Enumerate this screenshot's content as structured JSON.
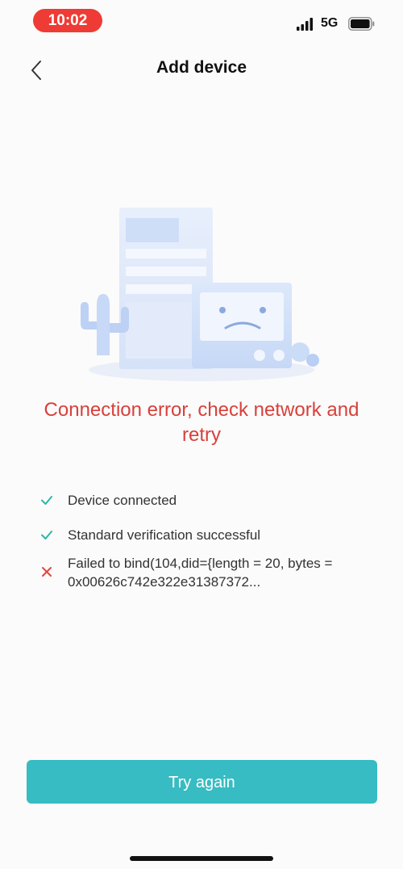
{
  "status_bar": {
    "time": "10:02",
    "network": "5G",
    "time_pill_color": "#ee3b35"
  },
  "nav": {
    "back_icon": "chevron-left-icon",
    "title": "Add device"
  },
  "illustration": {
    "description_icon": "sad-device-illustration"
  },
  "error": {
    "message": "Connection error, check network and retry",
    "color": "#d9403a"
  },
  "steps": [
    {
      "status": "success",
      "icon": "check-icon",
      "text": "Device connected"
    },
    {
      "status": "success",
      "icon": "check-icon",
      "text": "Standard verification successful"
    },
    {
      "status": "failed",
      "icon": "cross-icon",
      "text": "Failed to bind(104,did={length = 20, bytes = 0x00626c742e322e31387372..."
    }
  ],
  "actions": {
    "retry_label": "Try again",
    "accent_color": "#36bcc2"
  }
}
